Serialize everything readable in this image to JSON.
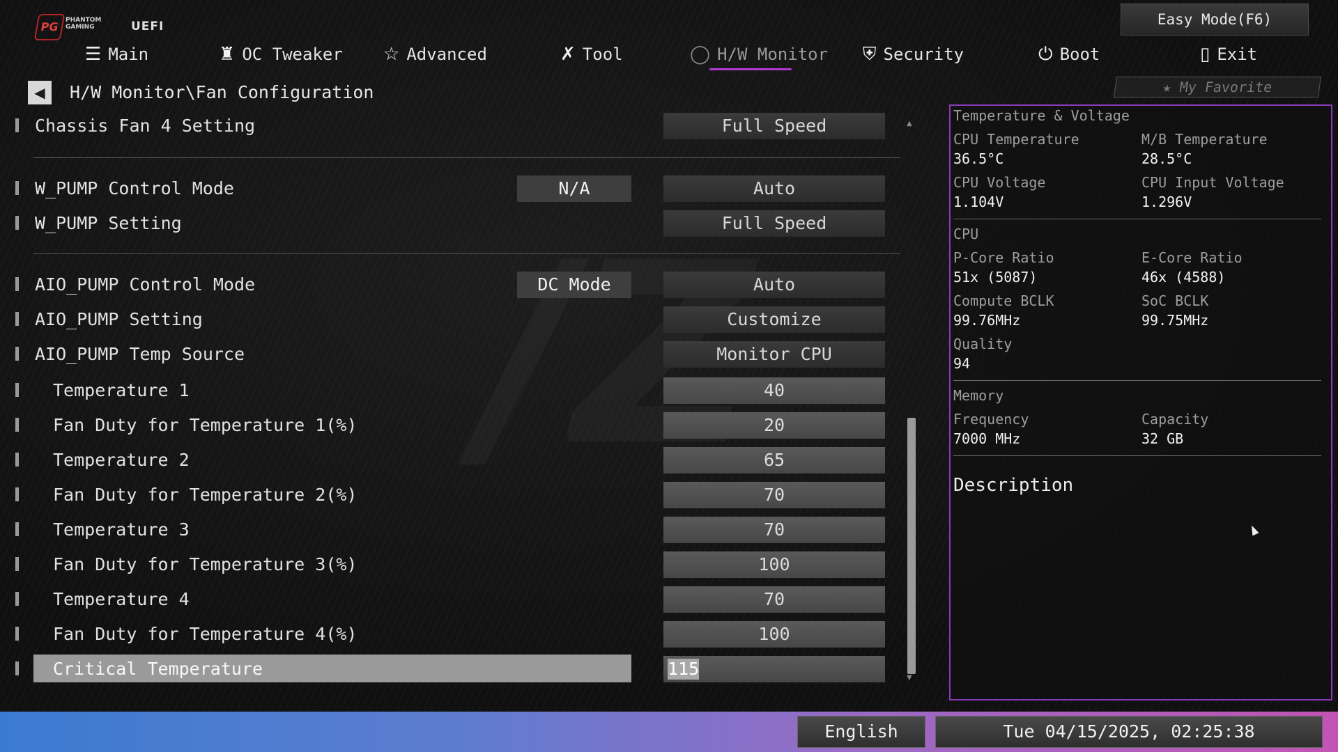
{
  "brand": {
    "logo_mark": "PG",
    "logo_text": "PHANTOM GAMING",
    "uefi": "UEFI"
  },
  "easy_mode": "Easy Mode(F6)",
  "nav": [
    {
      "label": "Main",
      "icon": "list-icon"
    },
    {
      "label": "OC Tweaker",
      "icon": "rocket-icon"
    },
    {
      "label": "Advanced",
      "icon": "star-icon"
    },
    {
      "label": "Tool",
      "icon": "wrench-icon"
    },
    {
      "label": "H/W Monitor",
      "icon": "gauge-icon",
      "active": true
    },
    {
      "label": "Security",
      "icon": "shield-icon"
    },
    {
      "label": "Boot",
      "icon": "power-icon"
    },
    {
      "label": "Exit",
      "icon": "exit-icon"
    }
  ],
  "breadcrumb": "H/W Monitor\\Fan Configuration",
  "favorite": "My Favorite",
  "settings": [
    {
      "label": "Chassis Fan 4 Setting",
      "value": "Full Speed"
    },
    {
      "label": "W_PUMP Control Mode",
      "mode": "N/A",
      "value": "Auto"
    },
    {
      "label": "W_PUMP Setting",
      "value": "Full Speed"
    },
    {
      "label": "AIO_PUMP Control Mode",
      "mode": "DC Mode",
      "value": "Auto"
    },
    {
      "label": "AIO_PUMP Setting",
      "value": "Customize"
    },
    {
      "label": "AIO_PUMP Temp Source",
      "value": "Monitor CPU"
    },
    {
      "label": "Temperature 1",
      "value": "40"
    },
    {
      "label": "Fan Duty for Temperature 1(%)",
      "value": "20"
    },
    {
      "label": "Temperature 2",
      "value": "65"
    },
    {
      "label": "Fan Duty for Temperature 2(%)",
      "value": "70"
    },
    {
      "label": "Temperature 3",
      "value": "70"
    },
    {
      "label": "Fan Duty for Temperature 3(%)",
      "value": "100"
    },
    {
      "label": "Temperature 4",
      "value": "70"
    },
    {
      "label": "Fan Duty for Temperature 4(%)",
      "value": "100"
    },
    {
      "label": "Critical Temperature",
      "value": "115"
    }
  ],
  "panel": {
    "section_temp": "Temperature & Voltage",
    "cpu_temp_label": "CPU Temperature",
    "cpu_temp": "36.5°C",
    "mb_temp_label": "M/B Temperature",
    "mb_temp": "28.5°C",
    "cpu_volt_label": "CPU Voltage",
    "cpu_volt": "1.104V",
    "cpu_input_label": "CPU Input Voltage",
    "cpu_input": "1.296V",
    "section_cpu": "CPU",
    "pcore_label": "P-Core Ratio",
    "pcore": "51x (5087)",
    "ecore_label": "E-Core Ratio",
    "ecore": "46x (4588)",
    "bclk_label": "Compute BCLK",
    "bclk": "99.76MHz",
    "soc_label": "SoC BCLK",
    "soc": "99.75MHz",
    "quality_label": "Quality",
    "quality": "94",
    "section_mem": "Memory",
    "freq_label": "Frequency",
    "freq": "7000 MHz",
    "cap_label": "Capacity",
    "cap": "32 GB",
    "description": "Description"
  },
  "footer": {
    "language": "English",
    "datetime": "Tue 04/15/2025, 02:25:38"
  }
}
